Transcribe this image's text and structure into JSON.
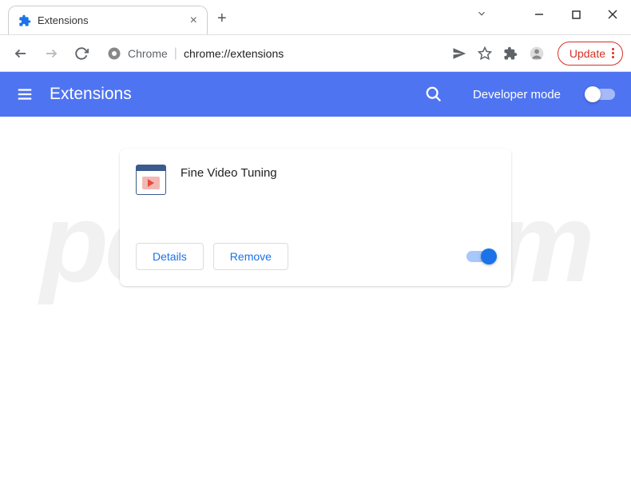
{
  "window": {
    "tab_title": "Extensions",
    "url_scheme": "Chrome",
    "url_path": "chrome://extensions"
  },
  "toolbar": {
    "update_label": "Update"
  },
  "header": {
    "title": "Extensions",
    "dev_mode_label": "Developer mode",
    "dev_mode_on": false
  },
  "extension": {
    "name": "Fine Video Tuning",
    "details_label": "Details",
    "remove_label": "Remove",
    "enabled": true
  },
  "watermark": "pcrisk.com"
}
